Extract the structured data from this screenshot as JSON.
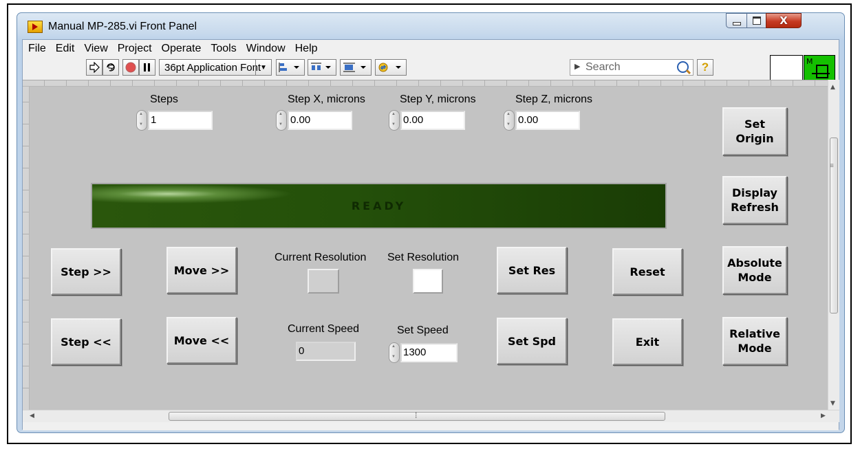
{
  "window": {
    "title": "Manual MP-285.vi Front Panel"
  },
  "menu": [
    "File",
    "Edit",
    "View",
    "Project",
    "Operate",
    "Tools",
    "Window",
    "Help"
  ],
  "toolbar": {
    "font": "36pt Application Font",
    "search_placeholder": "Search"
  },
  "vi_icon": {
    "letter": "M"
  },
  "fields": {
    "steps": {
      "label": "Steps",
      "value": "1"
    },
    "step_x": {
      "label": "Step X, microns",
      "value": "0.00"
    },
    "step_y": {
      "label": "Step Y, microns",
      "value": "0.00"
    },
    "step_z": {
      "label": "Step Z, microns",
      "value": "0.00"
    },
    "current_resolution": {
      "label": "Current Resolution"
    },
    "set_resolution": {
      "label": "Set Resolution"
    },
    "current_speed": {
      "label": "Current Speed",
      "value": "0"
    },
    "set_speed": {
      "label": "Set Speed",
      "value": "1300"
    }
  },
  "status": {
    "text": "READY"
  },
  "buttons": {
    "set_origin": "Set\nOrigin",
    "display_refresh": "Display\nRefresh",
    "absolute_mode": "Absolute\nMode",
    "relative_mode": "Relative\nMode",
    "step_fwd": "Step >>",
    "move_fwd": "Move >>",
    "step_back": "Step <<",
    "move_back": "Move <<",
    "set_res": "Set Res",
    "reset": "Reset",
    "set_spd": "Set Spd",
    "exit": "Exit"
  },
  "colors": {
    "panel": "#c3c3c3",
    "status_bg": "#24500a",
    "vi_icon_green": "#14c000"
  }
}
